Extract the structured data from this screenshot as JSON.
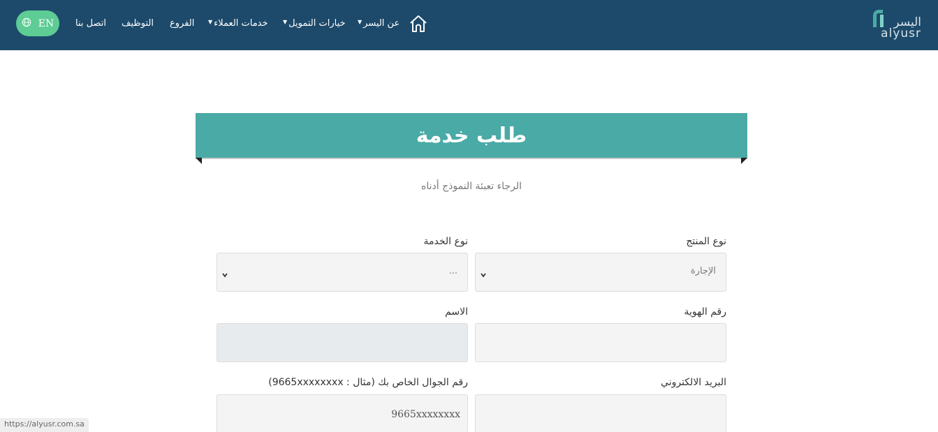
{
  "header": {
    "lang_button": "EN",
    "nav": {
      "about": "عن اليسر",
      "financing": "خيارات التمويل",
      "customer_services": "خدمات العملاء",
      "branches": "الفروع",
      "careers": "التوظيف",
      "contact": "اتصل بنا"
    },
    "logo_ar": "اليسر",
    "logo_en": "alyusr"
  },
  "banner": {
    "title": "طلب خدمة"
  },
  "subtitle": "الرجاء تعبئة النموذج أدناه",
  "form": {
    "product_type_label": "نوع المنتج",
    "product_type_value": "الإجارة",
    "service_type_label": "نوع الخدمة",
    "service_type_value": "...",
    "id_number_label": "رقم الهوية",
    "name_label": "الاسم",
    "email_label": "البريد الالكتروني",
    "mobile_label": "رقم الجوال الخاص بك (مثال : 9665xxxxxxxx)",
    "mobile_placeholder": "9665xxxxxxxx"
  },
  "status_bar": {
    "url": "https://alyusr.com.sa"
  },
  "colors": {
    "header_bg": "#1d4a6b",
    "accent_teal": "#4aaaa5",
    "lang_green": "#5dcc95"
  }
}
